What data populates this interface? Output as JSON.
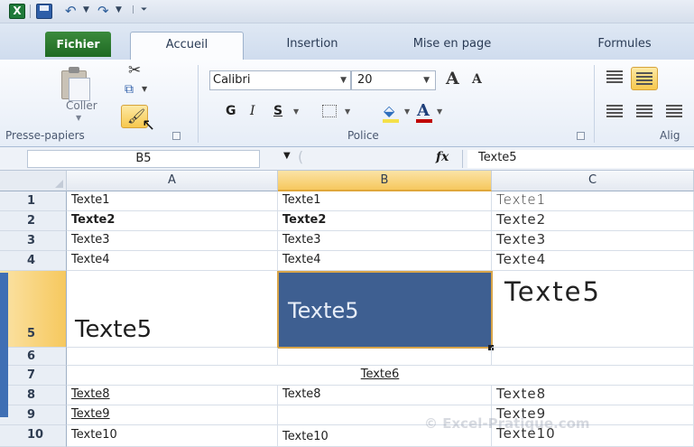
{
  "quick_access": {
    "icons": [
      "excel-logo",
      "save-icon",
      "undo-icon",
      "redo-icon",
      "customize-icon"
    ],
    "excel_letter": "X",
    "undo_glyph": "↶",
    "redo_glyph": "↷"
  },
  "tabs": [
    {
      "label": "Fichier"
    },
    {
      "label": "Accueil"
    },
    {
      "label": "Insertion"
    },
    {
      "label": "Mise en page"
    },
    {
      "label": "Formules"
    }
  ],
  "ribbon": {
    "clipboard": {
      "paste_label": "Coller",
      "group_label": "Presse-papiers"
    },
    "font": {
      "font_name": "Calibri",
      "font_size": "20",
      "grow_label": "A",
      "shrink_label": "A",
      "bold_label": "G",
      "italic_label": "I",
      "underline_label": "S",
      "color_label": "A",
      "group_label": "Police",
      "fill_color": "#f4e04a",
      "font_color": "#c00000"
    },
    "alignment": {
      "group_label": "Alig"
    }
  },
  "formula_bar": {
    "name_box": "B5",
    "fx_label": "fx",
    "content": "Texte5"
  },
  "grid": {
    "columns": [
      "A",
      "B",
      "C"
    ],
    "rows": [
      {
        "num": "1",
        "a": "Texte1",
        "b": "Texte1",
        "c": "Texte1"
      },
      {
        "num": "2",
        "a": "Texte2",
        "b": "Texte2",
        "c": "Texte2"
      },
      {
        "num": "3",
        "a": "Texte3",
        "b": "Texte3",
        "c": "Texte3"
      },
      {
        "num": "4",
        "a": "Texte4",
        "b": "Texte4",
        "c": "Texte4"
      },
      {
        "num": "5",
        "a": "Texte5",
        "b": "Texte5",
        "c": "Texte5"
      },
      {
        "num": "6",
        "a": "",
        "b": "",
        "c": ""
      },
      {
        "num": "7",
        "a": "",
        "b": "Texte6",
        "c": ""
      },
      {
        "num": "8",
        "a": "Texte8",
        "b": "Texte8",
        "c": "Texte8"
      },
      {
        "num": "9",
        "a": "Texte9",
        "b": "",
        "c": "Texte9"
      },
      {
        "num": "10",
        "a": "Texte10",
        "b": "Texte10",
        "c": "Texte10"
      }
    ],
    "selected_cell_fill": "#3e5f91",
    "selected_cell_text_color": "#e8eef8"
  },
  "watermark": "© Excel-Pratique.com"
}
